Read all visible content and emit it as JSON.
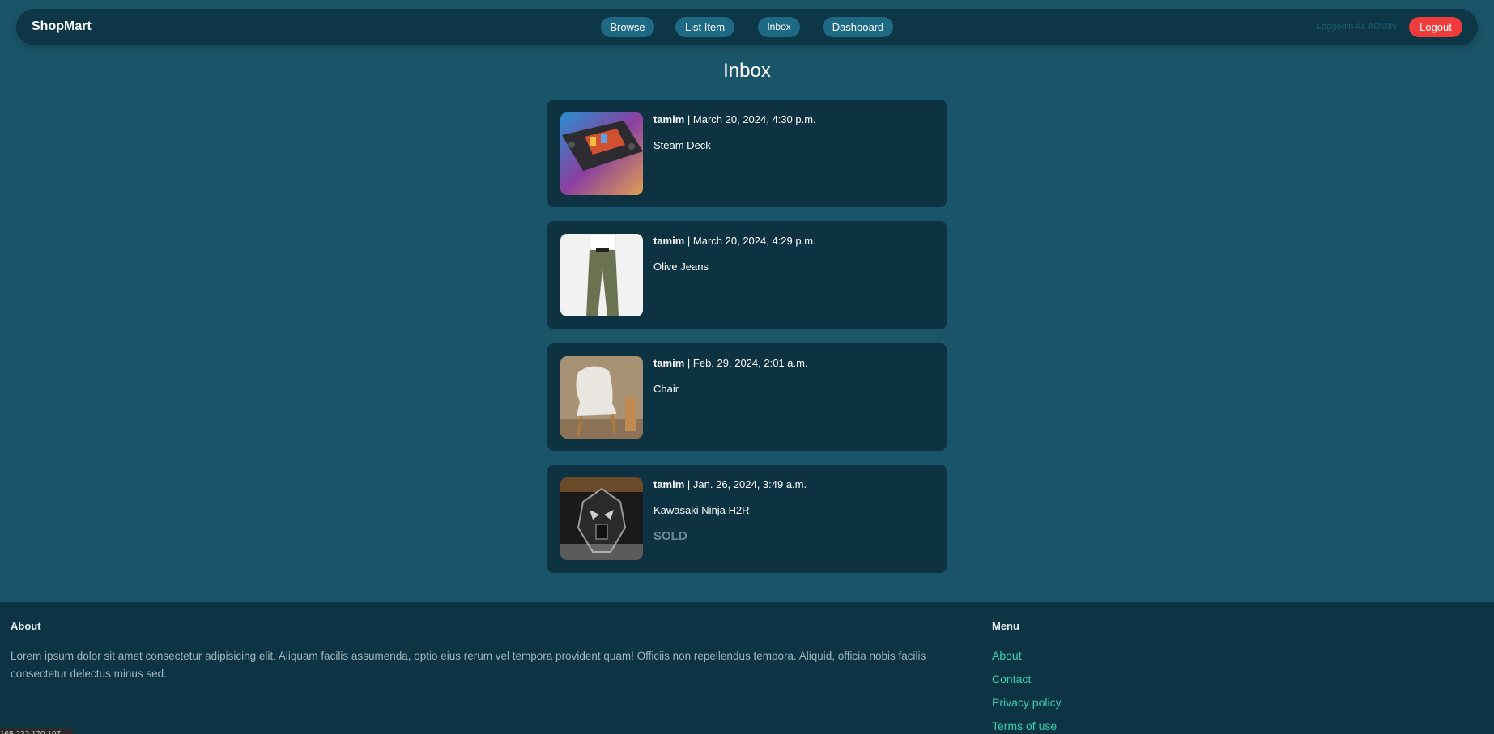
{
  "navbar": {
    "brand": "ShopMart",
    "links": [
      "Browse",
      "List Item",
      "Inbox",
      "Dashboard"
    ],
    "logged_in_text": "Loggedin As ADMIN",
    "logout_label": "Logout"
  },
  "page": {
    "title": "Inbox"
  },
  "messages": [
    {
      "sender": "tamim",
      "separator": " | ",
      "date": "March 20, 2024, 4:30 p.m.",
      "item": "Steam Deck",
      "status": ""
    },
    {
      "sender": "tamim",
      "separator": " | ",
      "date": "March 20, 2024, 4:29 p.m.",
      "item": "Olive Jeans",
      "status": ""
    },
    {
      "sender": "tamim",
      "separator": " | ",
      "date": "Feb. 29, 2024, 2:01 a.m.",
      "item": "Chair",
      "status": ""
    },
    {
      "sender": "tamim",
      "separator": " | ",
      "date": "Jan. 26, 2024, 3:49 a.m.",
      "item": "Kawasaki Ninja H2R",
      "status": "SOLD"
    }
  ],
  "footer": {
    "about_title": "About",
    "about_text": "Lorem ipsum dolor sit amet consectetur adipisicing elit. Aliquam facilis assumenda, optio eius rerum vel tempora provident quam! Officiis non repellendus tempora. Aliquid, officia nobis facilis consectetur delectus minus sed.",
    "menu_title": "Menu",
    "menu_links": [
      "About",
      "Contact",
      "Privacy policy",
      "Terms of use"
    ]
  },
  "status_bar": {
    "text": "165.232.170.107"
  },
  "colors": {
    "background": "#1a5468",
    "navbar": "#0d3646",
    "card": "#0d3343",
    "pill": "#1e6a85",
    "logout": "#ef3b3b",
    "footer_link": "#3ccfb0",
    "sold": "#6f8790"
  }
}
